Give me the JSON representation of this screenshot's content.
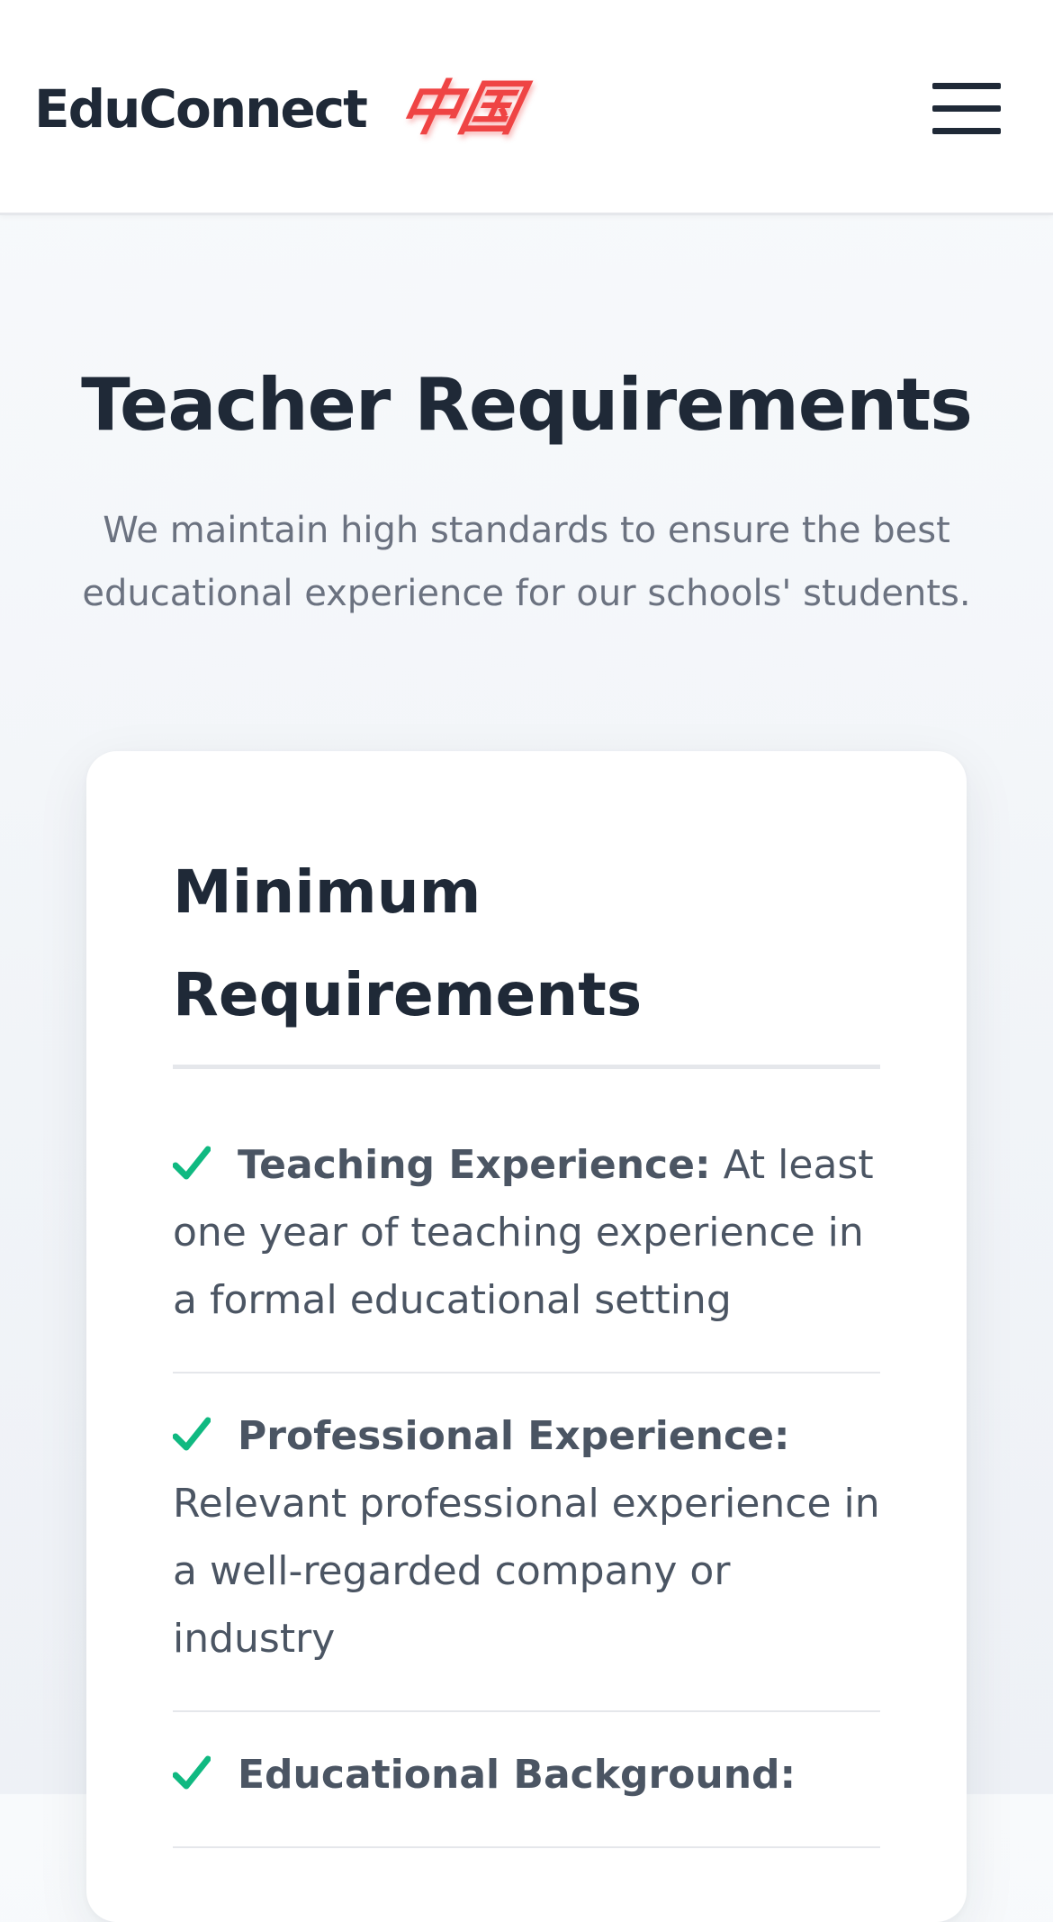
{
  "header": {
    "brand_name": "EduConnect",
    "brand_cn": "中国",
    "menu_icon": "hamburger-menu-icon"
  },
  "hero": {
    "title": "Teacher Requirements",
    "subtitle": "We maintain high standards to ensure the best educational experience for our schools' students."
  },
  "card": {
    "title": "Minimum Requirements",
    "items": [
      {
        "icon": "check-icon",
        "label": "Teaching Experience:",
        "text": "At least one year of teaching experience in a formal educational setting"
      },
      {
        "icon": "check-icon",
        "label": "Professional Experience:",
        "text": "Relevant professional experience in a well-regarded company or industry"
      },
      {
        "icon": "check-icon",
        "label": "Educational Background:",
        "text": ""
      }
    ]
  },
  "colors": {
    "brand_accent": "#ef4444",
    "check": "#10b981",
    "text_dark": "#1f2937",
    "text_muted": "#6b7280"
  }
}
